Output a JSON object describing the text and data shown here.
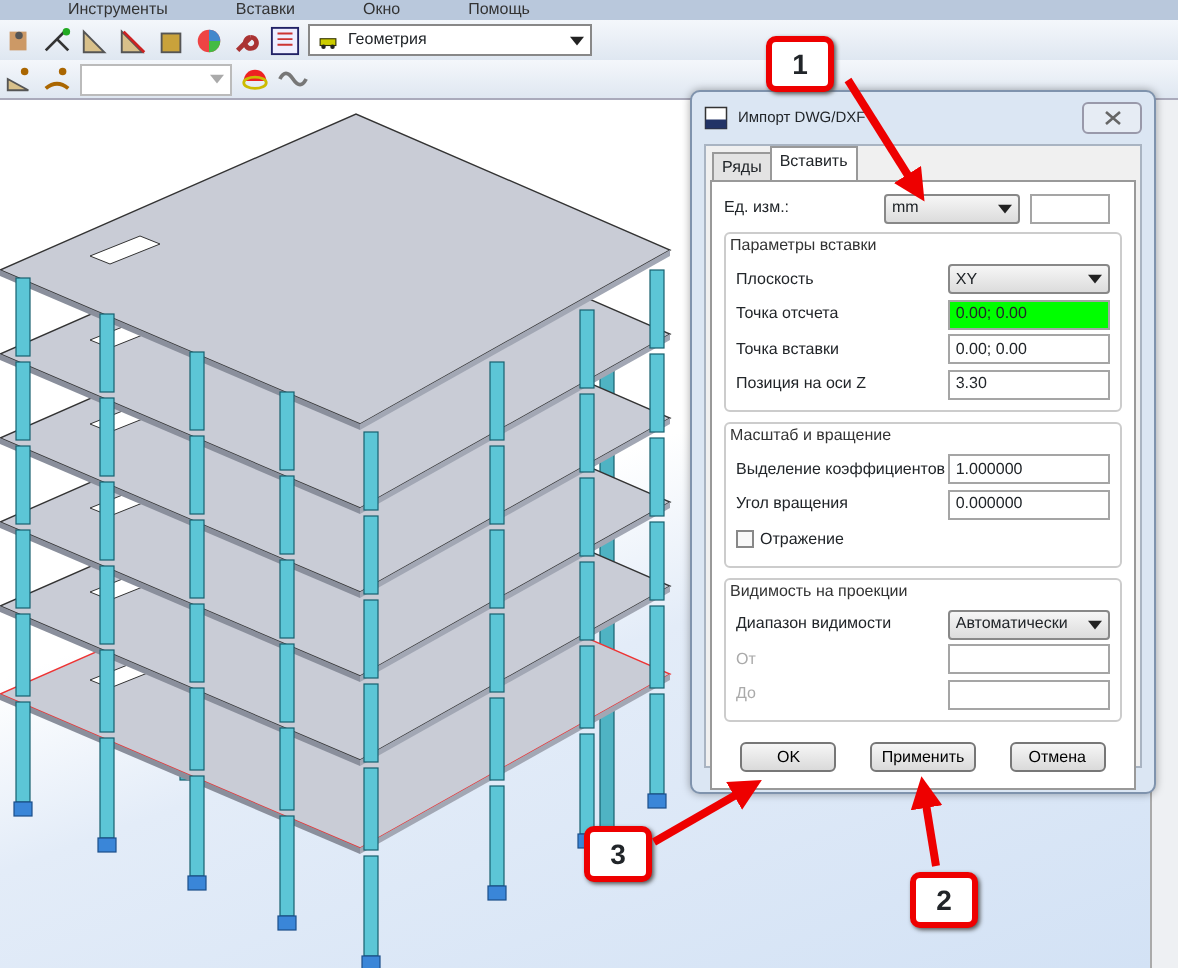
{
  "menu": [
    {
      "label": "Инструменты"
    },
    {
      "label": "Вставки"
    },
    {
      "label": "Окно"
    },
    {
      "label": "Помощь"
    }
  ],
  "toolbar": {
    "layer_select": "Геометрия"
  },
  "dialog": {
    "title": "Импорт DWG/DXF",
    "tabs": [
      {
        "label": "Ряды",
        "selected": false
      },
      {
        "label": "Вставить",
        "selected": true
      }
    ],
    "units": {
      "label": "Ед. изм.:",
      "value": "mm"
    },
    "groups": [
      {
        "title": "Параметры вставки",
        "rows": [
          {
            "kind": "select",
            "label": "Плоскость",
            "value": "XY",
            "disabled": false,
            "highlighted": false
          },
          {
            "kind": "input",
            "label": "Точка отсчета",
            "value": "0.00; 0.00",
            "disabled": false,
            "highlighted": true
          },
          {
            "kind": "input",
            "label": "Точка вставки",
            "value": "0.00; 0.00",
            "disabled": false,
            "highlighted": false
          },
          {
            "kind": "input",
            "label": "Позиция на оси Z",
            "value": "3.30",
            "disabled": false,
            "highlighted": false
          }
        ]
      },
      {
        "title": "Масштаб и вращение",
        "rows": [
          {
            "kind": "input",
            "label": "Выделение коэффициентов",
            "value": "1.000000",
            "disabled": false,
            "highlighted": false
          },
          {
            "kind": "input",
            "label": "Угол вращения",
            "value": "0.000000",
            "disabled": false,
            "highlighted": false
          },
          {
            "kind": "checkbox",
            "label": "Отражение",
            "checked": false
          }
        ]
      },
      {
        "title": "Видимость на проекции",
        "rows": [
          {
            "kind": "select",
            "label": "Диапазон видимости",
            "value": "Автоматически",
            "disabled": false,
            "highlighted": false
          },
          {
            "kind": "input",
            "label": "От",
            "disabled": true,
            "highlighted": false
          },
          {
            "kind": "input",
            "label": "До",
            "disabled": true,
            "highlighted": false
          }
        ]
      }
    ],
    "buttons": [
      {
        "label": "OK"
      },
      {
        "label": "Применить"
      },
      {
        "label": "Отмена"
      }
    ]
  },
  "callouts": [
    {
      "number": "1"
    },
    {
      "number": "2"
    },
    {
      "number": "3"
    }
  ]
}
